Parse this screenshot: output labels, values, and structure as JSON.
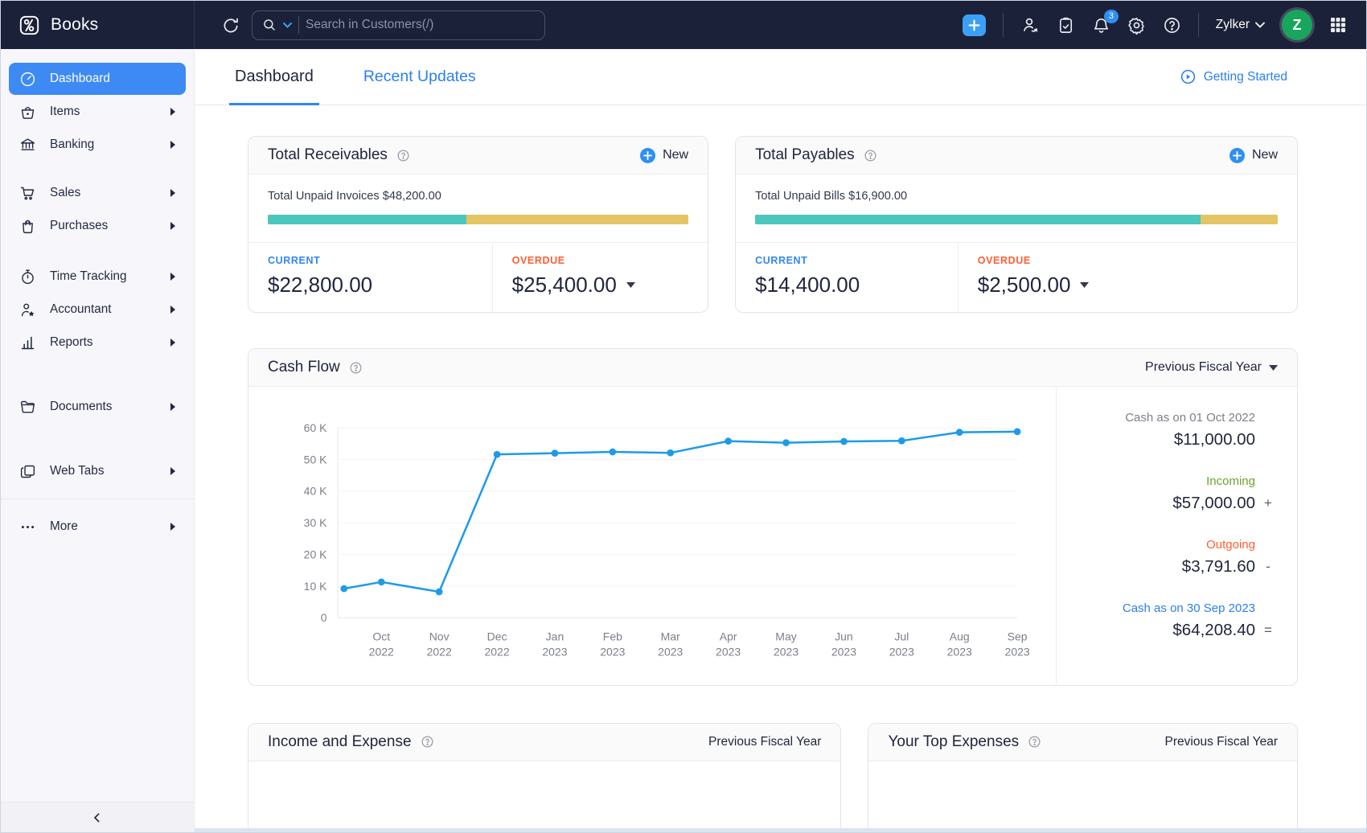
{
  "topbar": {
    "app_name": "Books",
    "search_placeholder": "Search in Customers(/)",
    "notification_count": "3",
    "org_name": "Zylker",
    "avatar_letter": "Z"
  },
  "sidebar": {
    "items": [
      {
        "label": "Dashboard"
      },
      {
        "label": "Items"
      },
      {
        "label": "Banking"
      },
      {
        "label": "Sales"
      },
      {
        "label": "Purchases"
      },
      {
        "label": "Time Tracking"
      },
      {
        "label": "Accountant"
      },
      {
        "label": "Reports"
      },
      {
        "label": "Documents"
      },
      {
        "label": "Web Tabs"
      },
      {
        "label": "More"
      }
    ]
  },
  "header": {
    "tabs": [
      {
        "label": "Dashboard"
      },
      {
        "label": "Recent Updates"
      }
    ],
    "getting_started": "Getting Started"
  },
  "stat_cards": [
    {
      "title": "Total Receivables",
      "new_label": "New",
      "summary": "Total Unpaid Invoices $48,200.00",
      "current_label": "CURRENT",
      "current_value": "$22,800.00",
      "overdue_label": "OVERDUE",
      "overdue_value": "$25,400.00",
      "progress_percent": 47.3
    },
    {
      "title": "Total Payables",
      "new_label": "New",
      "summary": "Total Unpaid Bills $16,900.00",
      "current_label": "CURRENT",
      "current_value": "$14,400.00",
      "overdue_label": "OVERDUE",
      "overdue_value": "$2,500.00",
      "progress_percent": 85.2
    }
  ],
  "cashflow": {
    "title": "Cash Flow",
    "period_selector": "Previous Fiscal Year",
    "summary": [
      {
        "label": "Cash as on 01 Oct 2022",
        "value": "$11,000.00",
        "operator": ""
      },
      {
        "label": "Incoming",
        "value": "$57,000.00",
        "operator": "+"
      },
      {
        "label": "Outgoing",
        "value": "$3,791.60",
        "operator": "-"
      },
      {
        "label": "Cash as on 30 Sep 2023",
        "value": "$64,208.40",
        "operator": "="
      }
    ]
  },
  "chart_data": {
    "type": "line",
    "title": "Cash Flow",
    "x": [
      "Oct 2022",
      "Nov 2022",
      "Dec 2022",
      "Jan 2023",
      "Feb 2023",
      "Mar 2023",
      "Apr 2023",
      "May 2023",
      "Jun 2023",
      "Jul 2023",
      "Aug 2023",
      "Sep 2023"
    ],
    "opening_point": {
      "label": "01 Oct 2022",
      "value": 9200
    },
    "values": [
      11300,
      8200,
      51600,
      52000,
      52400,
      52100,
      55800,
      55300,
      55700,
      55900,
      58600,
      58800
    ],
    "ylim": [
      0,
      60000
    ],
    "y_ticks": [
      "0",
      "10 K",
      "20 K",
      "30 K",
      "40 K",
      "50 K",
      "60 K"
    ],
    "xlabel": "",
    "ylabel": "",
    "grid": true,
    "legend": "none",
    "line_color": "#1d9be8"
  },
  "bottom_cards": [
    {
      "title": "Income and Expense",
      "period_selector": "Previous Fiscal Year"
    },
    {
      "title": "Your Top Expenses",
      "period_selector": "Previous Fiscal Year"
    }
  ],
  "colors": {
    "topbar_bg": "#1b2138",
    "sidebar_active": "#3d8af5",
    "accent_blue": "#2b7ff2",
    "current_blue": "#2f87f2",
    "overdue_orange": "#ff5e32",
    "incoming_green": "#68a52d",
    "progress_teal": "#4bc7be",
    "progress_yellow": "#e3c565",
    "chart_line": "#1d9be8",
    "avatar_green": "#17a65c"
  }
}
